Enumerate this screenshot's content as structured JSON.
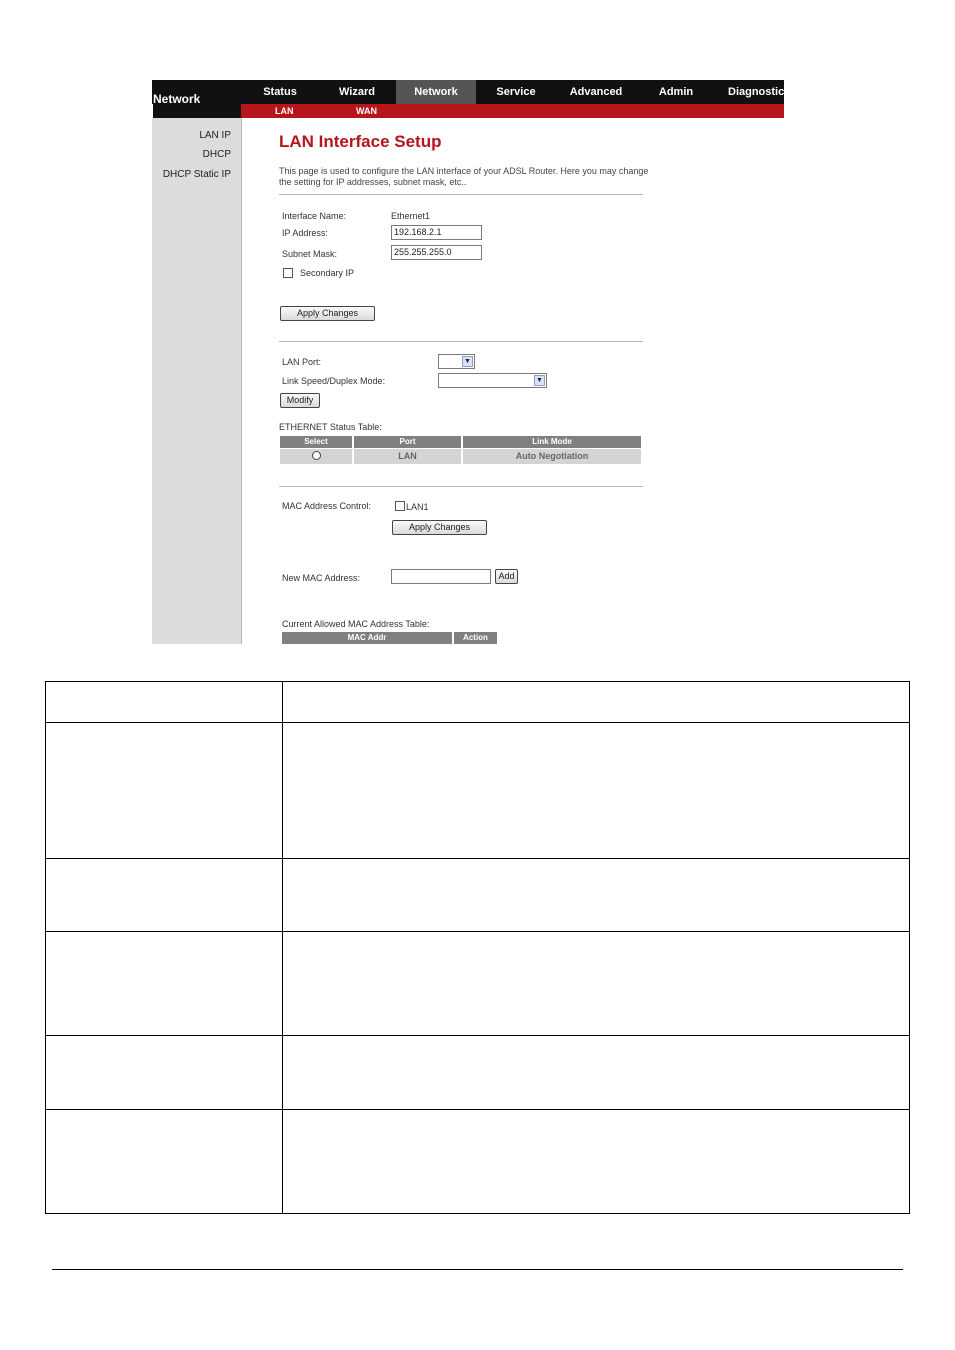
{
  "header": {
    "brand": "Network",
    "menu": [
      "Status",
      "Wizard",
      "Network",
      "Service",
      "Advanced",
      "Admin",
      "Diagnostic"
    ],
    "active_menu": "Network",
    "submenu": [
      "LAN",
      "WAN"
    ]
  },
  "sidebar": {
    "items": [
      "LAN IP",
      "DHCP",
      "DHCP Static IP"
    ]
  },
  "main": {
    "title": "LAN Interface Setup",
    "description": "This page is used to configure the LAN interface of your ADSL Router. Here you may change the setting for IP addresses, subnet mask, etc..",
    "interface_name_label": "Interface Name:",
    "interface_name_value": "Ethernet1",
    "ip_label": "IP Address:",
    "ip_value": "192.168.2.1",
    "mask_label": "Subnet Mask:",
    "mask_value": "255.255.255.0",
    "secondary_ip_label": "Secondary IP",
    "apply_label": "Apply Changes",
    "lan_port_label": "LAN Port:",
    "link_speed_label": "Link Speed/Duplex Mode:",
    "modify_label": "Modify",
    "eth_table_title": "ETHERNET Status Table:",
    "eth_table_headers": [
      "Select",
      "Port",
      "Link Mode"
    ],
    "eth_table_row": {
      "port": "LAN",
      "link_mode": "Auto Negotiation"
    },
    "mac_control_label": "MAC Address Control:",
    "mac_lan1_label": "LAN1",
    "apply2_label": "Apply Changes",
    "new_mac_label": "New MAC Address:",
    "add_label": "Add",
    "allowed_table_title": "Current Allowed MAC Address Table:",
    "allowed_table_headers": [
      "MAC Addr",
      "Action"
    ]
  },
  "colors": {
    "accent_red": "#b5151b",
    "menu_bg": "#111111",
    "active_menu_bg": "#555555",
    "sidebar_bg": "#dcdcdc"
  }
}
